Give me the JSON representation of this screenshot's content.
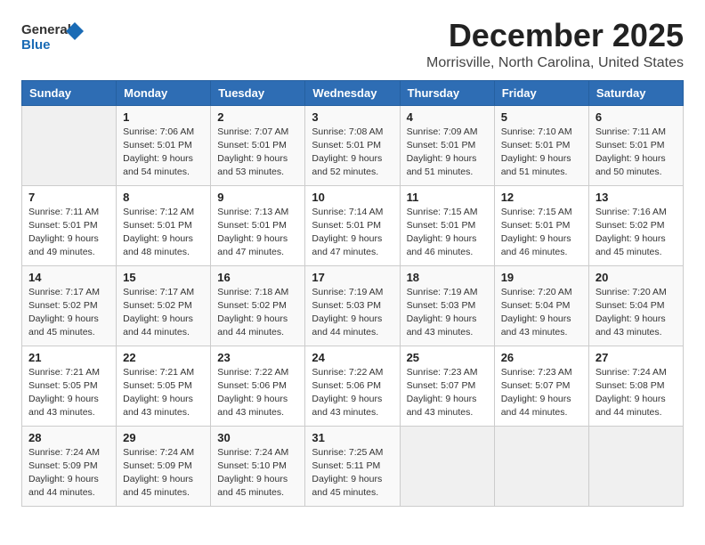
{
  "logo": {
    "general": "General",
    "blue": "Blue"
  },
  "header": {
    "month": "December 2025",
    "location": "Morrisville, North Carolina, United States"
  },
  "weekdays": [
    "Sunday",
    "Monday",
    "Tuesday",
    "Wednesday",
    "Thursday",
    "Friday",
    "Saturday"
  ],
  "weeks": [
    [
      {
        "day": "",
        "info": ""
      },
      {
        "day": "1",
        "info": "Sunrise: 7:06 AM\nSunset: 5:01 PM\nDaylight: 9 hours\nand 54 minutes."
      },
      {
        "day": "2",
        "info": "Sunrise: 7:07 AM\nSunset: 5:01 PM\nDaylight: 9 hours\nand 53 minutes."
      },
      {
        "day": "3",
        "info": "Sunrise: 7:08 AM\nSunset: 5:01 PM\nDaylight: 9 hours\nand 52 minutes."
      },
      {
        "day": "4",
        "info": "Sunrise: 7:09 AM\nSunset: 5:01 PM\nDaylight: 9 hours\nand 51 minutes."
      },
      {
        "day": "5",
        "info": "Sunrise: 7:10 AM\nSunset: 5:01 PM\nDaylight: 9 hours\nand 51 minutes."
      },
      {
        "day": "6",
        "info": "Sunrise: 7:11 AM\nSunset: 5:01 PM\nDaylight: 9 hours\nand 50 minutes."
      }
    ],
    [
      {
        "day": "7",
        "info": "Sunrise: 7:11 AM\nSunset: 5:01 PM\nDaylight: 9 hours\nand 49 minutes."
      },
      {
        "day": "8",
        "info": "Sunrise: 7:12 AM\nSunset: 5:01 PM\nDaylight: 9 hours\nand 48 minutes."
      },
      {
        "day": "9",
        "info": "Sunrise: 7:13 AM\nSunset: 5:01 PM\nDaylight: 9 hours\nand 47 minutes."
      },
      {
        "day": "10",
        "info": "Sunrise: 7:14 AM\nSunset: 5:01 PM\nDaylight: 9 hours\nand 47 minutes."
      },
      {
        "day": "11",
        "info": "Sunrise: 7:15 AM\nSunset: 5:01 PM\nDaylight: 9 hours\nand 46 minutes."
      },
      {
        "day": "12",
        "info": "Sunrise: 7:15 AM\nSunset: 5:01 PM\nDaylight: 9 hours\nand 46 minutes."
      },
      {
        "day": "13",
        "info": "Sunrise: 7:16 AM\nSunset: 5:02 PM\nDaylight: 9 hours\nand 45 minutes."
      }
    ],
    [
      {
        "day": "14",
        "info": "Sunrise: 7:17 AM\nSunset: 5:02 PM\nDaylight: 9 hours\nand 45 minutes."
      },
      {
        "day": "15",
        "info": "Sunrise: 7:17 AM\nSunset: 5:02 PM\nDaylight: 9 hours\nand 44 minutes."
      },
      {
        "day": "16",
        "info": "Sunrise: 7:18 AM\nSunset: 5:02 PM\nDaylight: 9 hours\nand 44 minutes."
      },
      {
        "day": "17",
        "info": "Sunrise: 7:19 AM\nSunset: 5:03 PM\nDaylight: 9 hours\nand 44 minutes."
      },
      {
        "day": "18",
        "info": "Sunrise: 7:19 AM\nSunset: 5:03 PM\nDaylight: 9 hours\nand 43 minutes."
      },
      {
        "day": "19",
        "info": "Sunrise: 7:20 AM\nSunset: 5:04 PM\nDaylight: 9 hours\nand 43 minutes."
      },
      {
        "day": "20",
        "info": "Sunrise: 7:20 AM\nSunset: 5:04 PM\nDaylight: 9 hours\nand 43 minutes."
      }
    ],
    [
      {
        "day": "21",
        "info": "Sunrise: 7:21 AM\nSunset: 5:05 PM\nDaylight: 9 hours\nand 43 minutes."
      },
      {
        "day": "22",
        "info": "Sunrise: 7:21 AM\nSunset: 5:05 PM\nDaylight: 9 hours\nand 43 minutes."
      },
      {
        "day": "23",
        "info": "Sunrise: 7:22 AM\nSunset: 5:06 PM\nDaylight: 9 hours\nand 43 minutes."
      },
      {
        "day": "24",
        "info": "Sunrise: 7:22 AM\nSunset: 5:06 PM\nDaylight: 9 hours\nand 43 minutes."
      },
      {
        "day": "25",
        "info": "Sunrise: 7:23 AM\nSunset: 5:07 PM\nDaylight: 9 hours\nand 43 minutes."
      },
      {
        "day": "26",
        "info": "Sunrise: 7:23 AM\nSunset: 5:07 PM\nDaylight: 9 hours\nand 44 minutes."
      },
      {
        "day": "27",
        "info": "Sunrise: 7:24 AM\nSunset: 5:08 PM\nDaylight: 9 hours\nand 44 minutes."
      }
    ],
    [
      {
        "day": "28",
        "info": "Sunrise: 7:24 AM\nSunset: 5:09 PM\nDaylight: 9 hours\nand 44 minutes."
      },
      {
        "day": "29",
        "info": "Sunrise: 7:24 AM\nSunset: 5:09 PM\nDaylight: 9 hours\nand 45 minutes."
      },
      {
        "day": "30",
        "info": "Sunrise: 7:24 AM\nSunset: 5:10 PM\nDaylight: 9 hours\nand 45 minutes."
      },
      {
        "day": "31",
        "info": "Sunrise: 7:25 AM\nSunset: 5:11 PM\nDaylight: 9 hours\nand 45 minutes."
      },
      {
        "day": "",
        "info": ""
      },
      {
        "day": "",
        "info": ""
      },
      {
        "day": "",
        "info": ""
      }
    ]
  ]
}
